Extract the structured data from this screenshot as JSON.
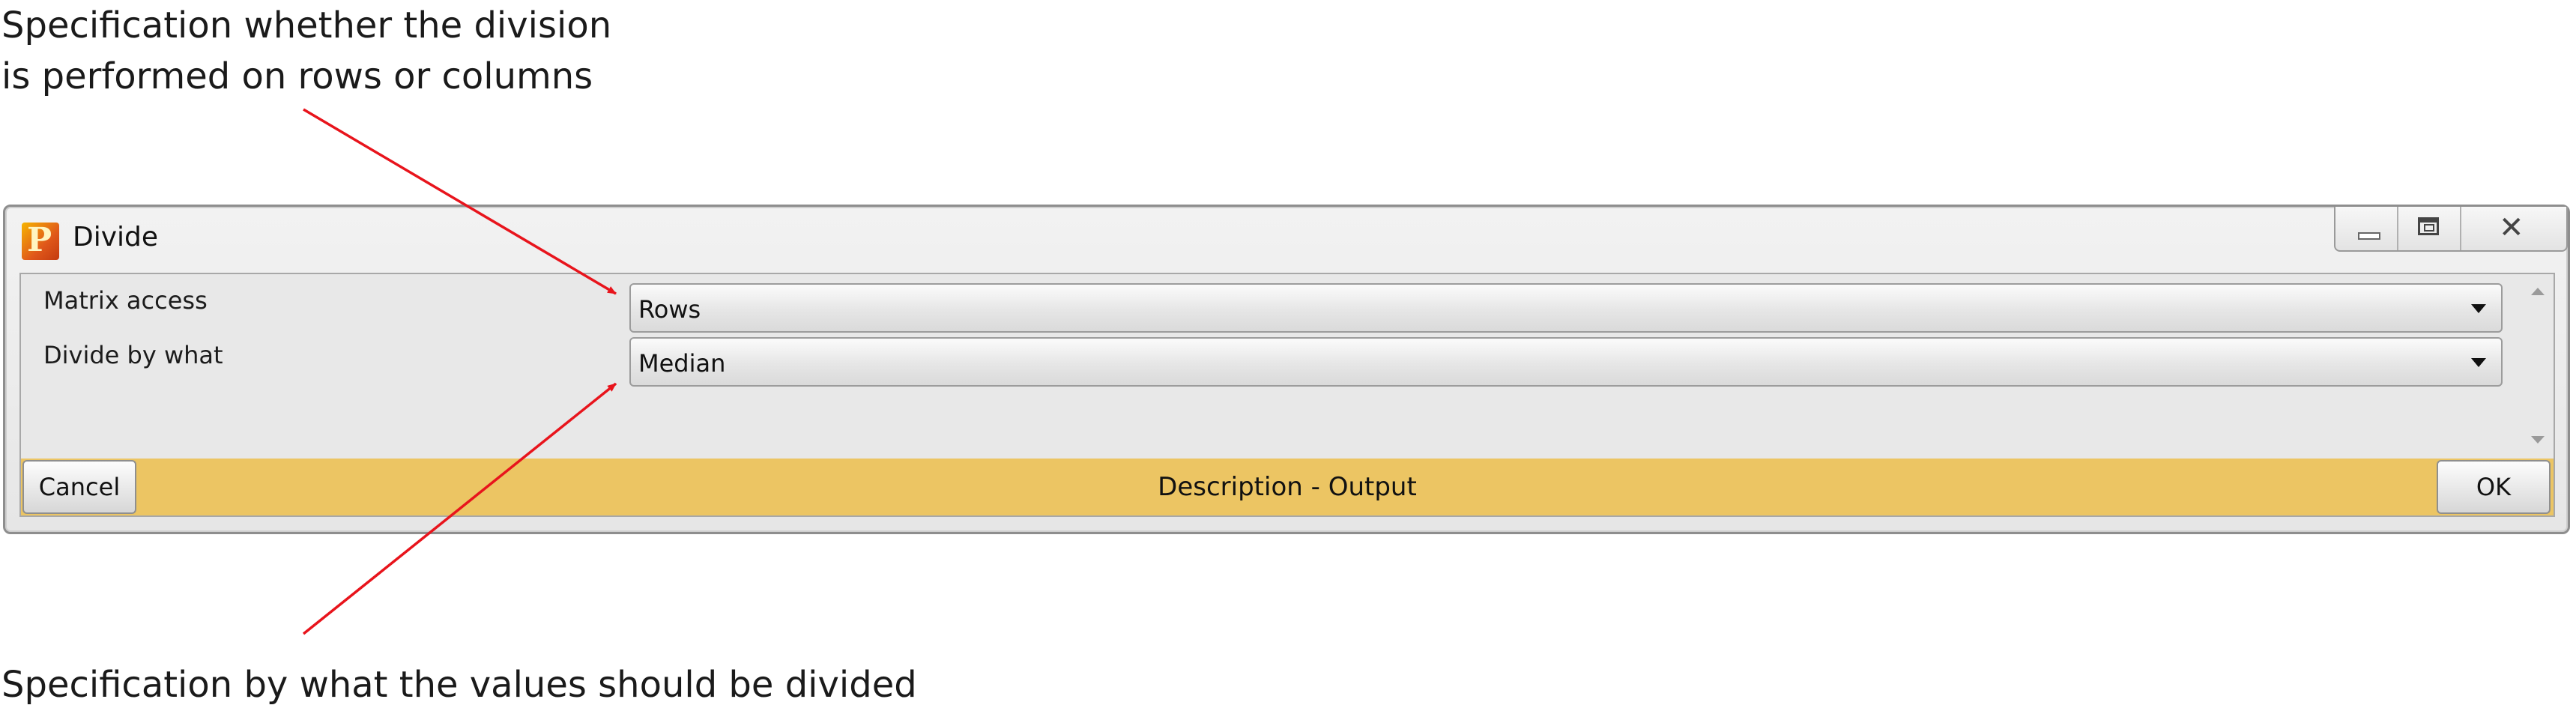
{
  "annotations": {
    "top_line1": "Specification whether the division",
    "top_line2": "is performed on rows or columns",
    "bottom": "Specification by what the values should be divided"
  },
  "window": {
    "title": "Divide",
    "icon": "app-p-icon",
    "controls": [
      "minimize-icon",
      "maximize-icon",
      "close-icon"
    ]
  },
  "form": {
    "matrix_access": {
      "label": "Matrix access",
      "value": "Rows"
    },
    "divide_by": {
      "label": "Divide by what",
      "value": "Median"
    }
  },
  "footer": {
    "cancel_label": "Cancel",
    "center_text": "Description - Output",
    "ok_label": "OK",
    "bar_color": "#ecc563"
  },
  "colors": {
    "annotation_arrow": "#e8141c"
  }
}
